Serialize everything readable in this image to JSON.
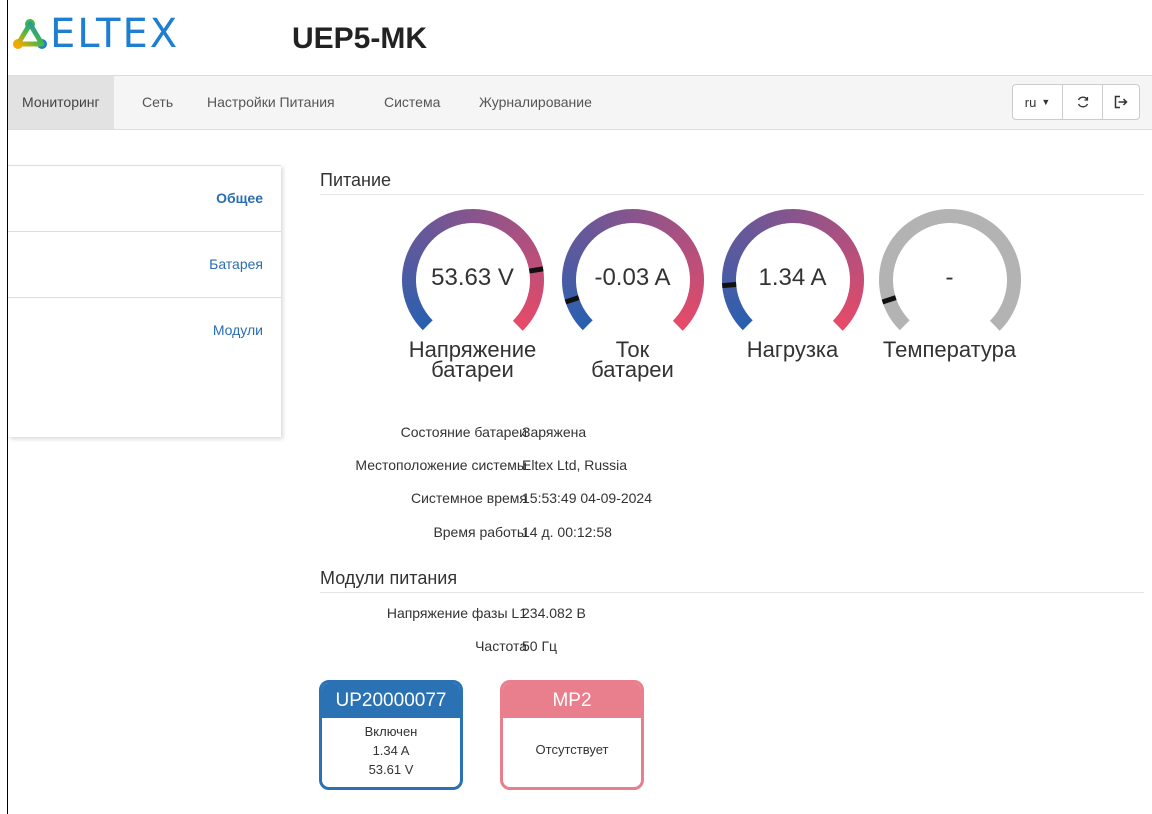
{
  "header": {
    "logo_text": "ELTEX",
    "device_name": "UEP5-MK"
  },
  "nav": {
    "items": [
      {
        "label": "Мониторинг",
        "active": true
      },
      {
        "label": "Сеть"
      },
      {
        "label": "Настройки Питания"
      },
      {
        "label": "Система"
      },
      {
        "label": "Журналирование"
      }
    ],
    "lang_label": "ru",
    "refresh_icon": "refresh-icon",
    "logout_icon": "logout-icon"
  },
  "sidebar": {
    "items": [
      {
        "label": "Общее",
        "active": true
      },
      {
        "label": "Батарея"
      },
      {
        "label": "Модули"
      }
    ]
  },
  "power": {
    "title": "Питание",
    "gauges": [
      {
        "value": "53.63 V",
        "label_line1": "Напряжение",
        "label_line2": "батареи",
        "level": 0.8,
        "colored": true
      },
      {
        "value": "-0.03 A",
        "label_line1": "Ток",
        "label_line2": "батареи",
        "level": 0.1,
        "colored": true
      },
      {
        "value": "1.34 A",
        "label_line1": "Нагрузка",
        "label_line2": "",
        "level": 0.15,
        "colored": true
      },
      {
        "value": "-",
        "label_line1": "Температура",
        "label_line2": "",
        "level": 0.1,
        "colored": false
      }
    ]
  },
  "system_info": [
    {
      "key": "Состояние батареи",
      "value": "Заряжена"
    },
    {
      "key": "Местоположение системы",
      "value": "Eltex Ltd, Russia"
    },
    {
      "key": "Системное время",
      "value": "15:53:49 04-09-2024"
    },
    {
      "key": "Время работы",
      "value": "14 д. 00:12:58"
    }
  ],
  "modules": {
    "title": "Модули питания",
    "info": [
      {
        "key": "Напряжение фазы L1",
        "value": "234.082 В"
      },
      {
        "key": "Частота",
        "value": "50 Гц"
      }
    ],
    "cards": [
      {
        "name": "UP20000077",
        "lines": [
          "Включен",
          "1.34 A",
          "53.61 V"
        ],
        "color": "#2b72b5"
      },
      {
        "name": "MP2",
        "lines": [
          "Отсутствует"
        ],
        "color": "#e97f8c"
      }
    ]
  },
  "colors": {
    "brand_blue": "#1e7fd1",
    "gauge_start": "#2a5fb0",
    "gauge_end": "#e84a68",
    "gauge_empty": "#b3b3b3"
  }
}
